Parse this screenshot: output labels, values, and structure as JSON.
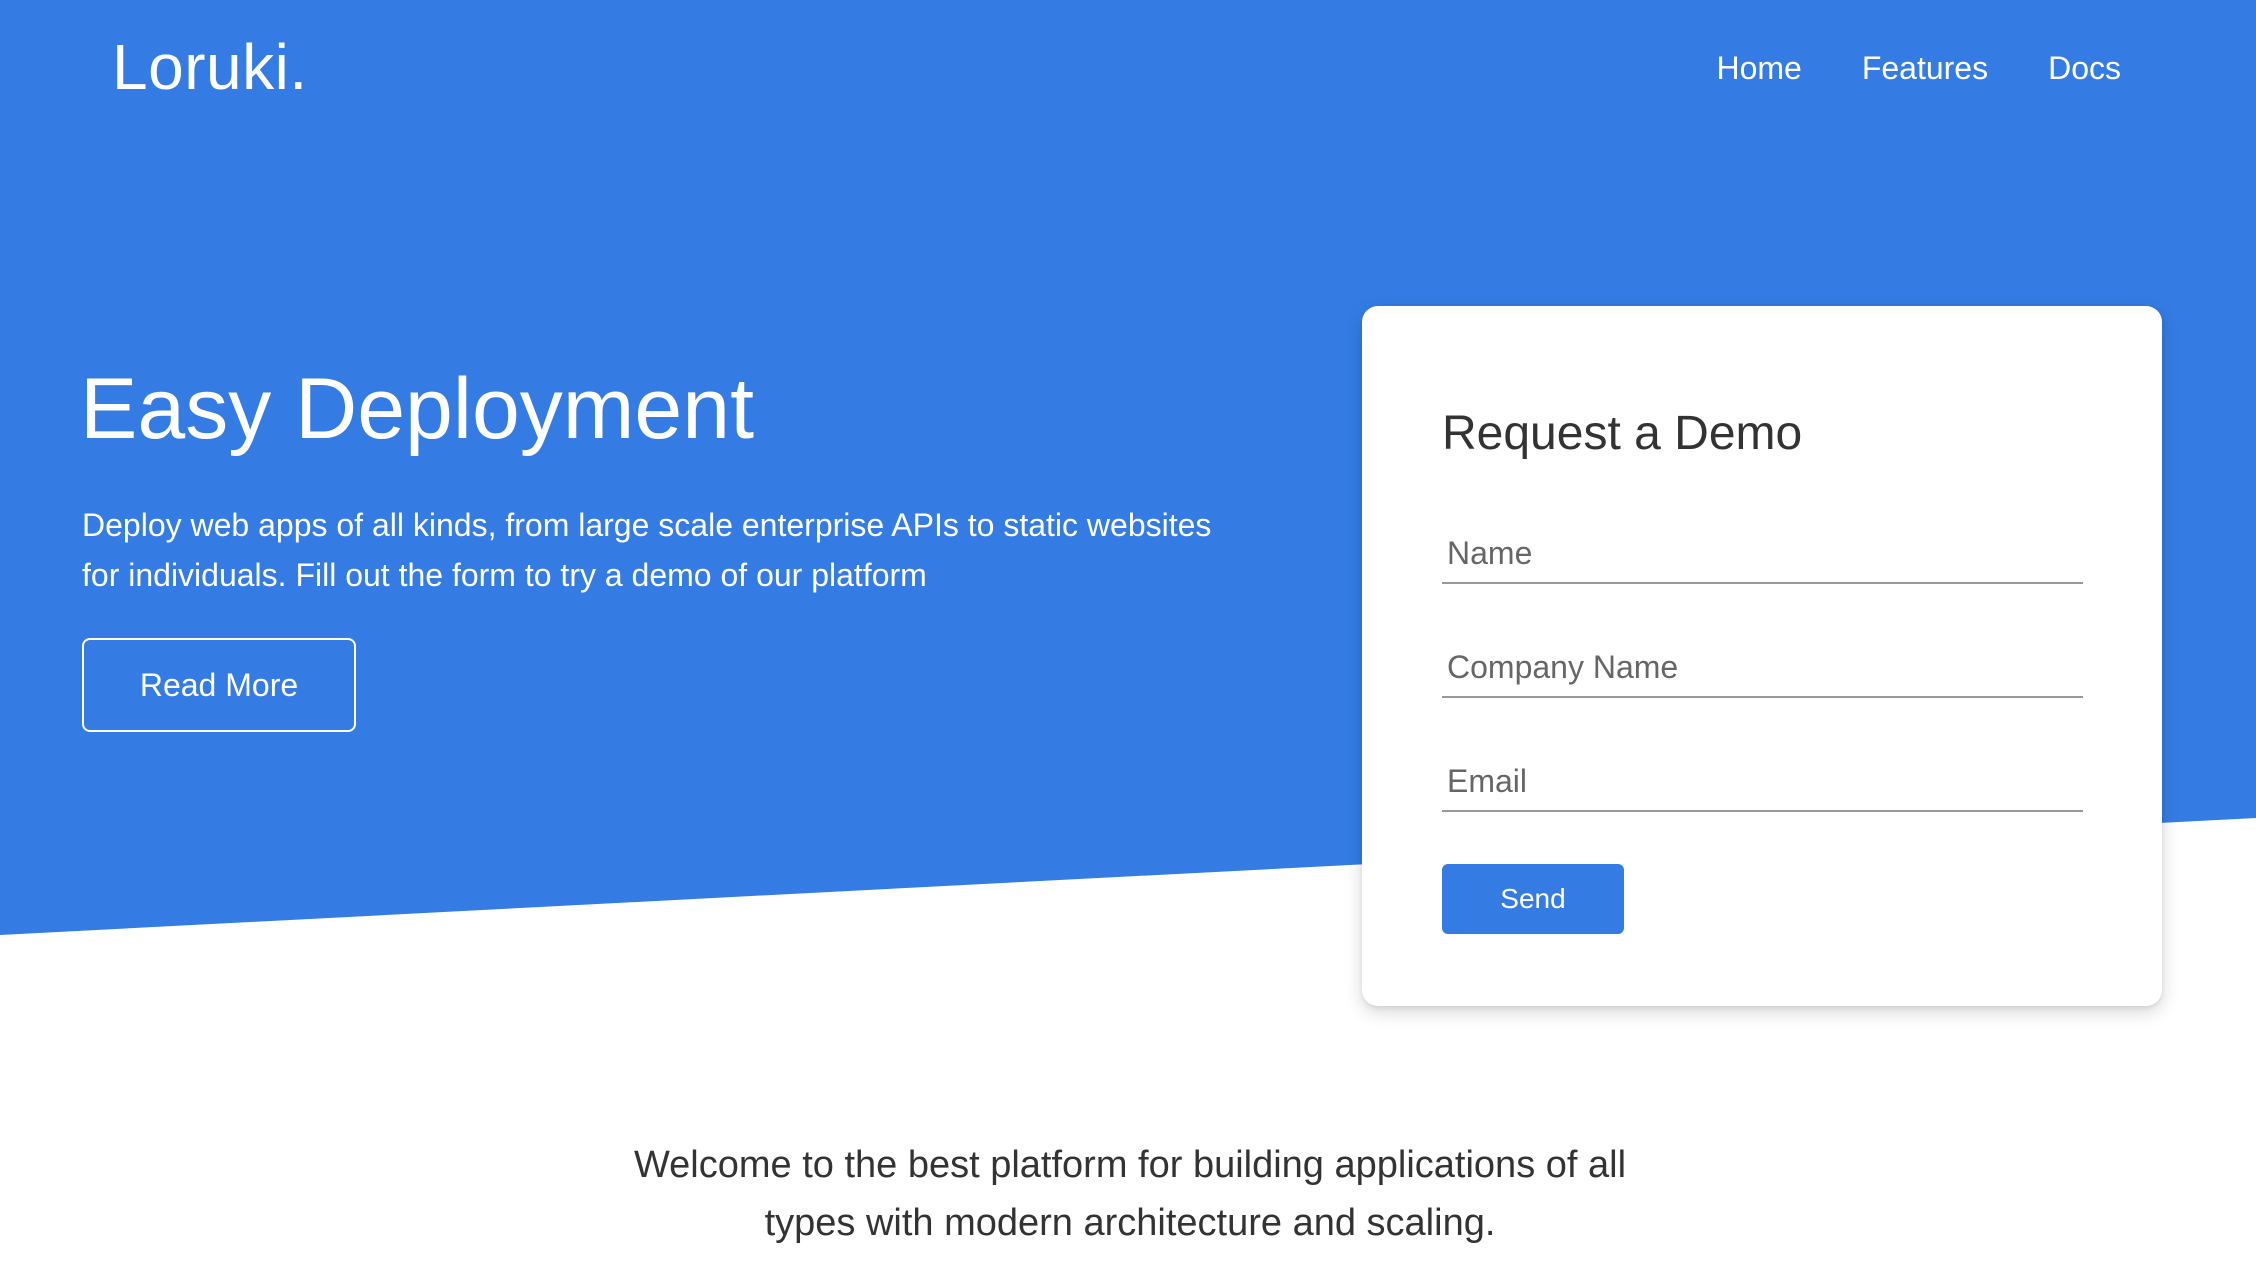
{
  "header": {
    "logo": "Loruki.",
    "nav": [
      {
        "label": "Home"
      },
      {
        "label": "Features"
      },
      {
        "label": "Docs"
      }
    ]
  },
  "hero": {
    "title": "Easy Deployment",
    "text": "Deploy web apps of all kinds, from large scale enterprise APIs to static websites for individuals. Fill out the form to try a demo of our platform",
    "button_label": "Read More"
  },
  "form": {
    "title": "Request a Demo",
    "name_placeholder": "Name",
    "company_placeholder": "Company Name",
    "email_placeholder": "Email",
    "send_label": "Send"
  },
  "welcome": {
    "text": "Welcome to the best platform for building applications of all types with modern architecture and scaling."
  },
  "colors": {
    "primary": "#347ce4",
    "background": "#ffffff",
    "text": "#333333"
  }
}
